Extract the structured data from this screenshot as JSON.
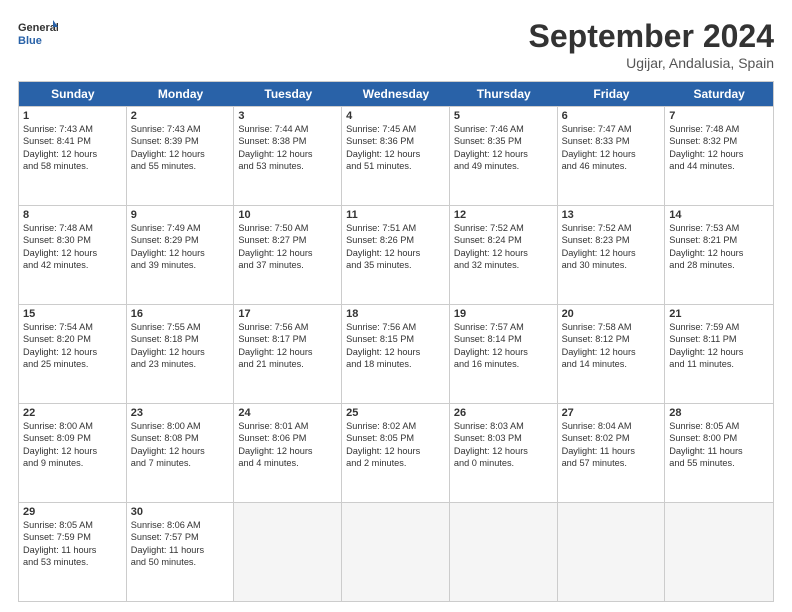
{
  "logo": {
    "text_general": "General",
    "text_blue": "Blue"
  },
  "header": {
    "month": "September 2024",
    "location": "Ugijar, Andalusia, Spain"
  },
  "weekdays": [
    "Sunday",
    "Monday",
    "Tuesday",
    "Wednesday",
    "Thursday",
    "Friday",
    "Saturday"
  ],
  "rows": [
    [
      {
        "day": "",
        "empty": true,
        "lines": []
      },
      {
        "day": "",
        "empty": true,
        "lines": []
      },
      {
        "day": "",
        "empty": true,
        "lines": []
      },
      {
        "day": "",
        "empty": true,
        "lines": []
      },
      {
        "day": "",
        "empty": true,
        "lines": []
      },
      {
        "day": "",
        "empty": true,
        "lines": []
      },
      {
        "day": "",
        "empty": true,
        "lines": []
      }
    ],
    [
      {
        "day": "1",
        "empty": false,
        "lines": [
          "Sunrise: 7:43 AM",
          "Sunset: 8:41 PM",
          "Daylight: 12 hours",
          "and 58 minutes."
        ]
      },
      {
        "day": "2",
        "empty": false,
        "lines": [
          "Sunrise: 7:43 AM",
          "Sunset: 8:39 PM",
          "Daylight: 12 hours",
          "and 55 minutes."
        ]
      },
      {
        "day": "3",
        "empty": false,
        "lines": [
          "Sunrise: 7:44 AM",
          "Sunset: 8:38 PM",
          "Daylight: 12 hours",
          "and 53 minutes."
        ]
      },
      {
        "day": "4",
        "empty": false,
        "lines": [
          "Sunrise: 7:45 AM",
          "Sunset: 8:36 PM",
          "Daylight: 12 hours",
          "and 51 minutes."
        ]
      },
      {
        "day": "5",
        "empty": false,
        "lines": [
          "Sunrise: 7:46 AM",
          "Sunset: 8:35 PM",
          "Daylight: 12 hours",
          "and 49 minutes."
        ]
      },
      {
        "day": "6",
        "empty": false,
        "lines": [
          "Sunrise: 7:47 AM",
          "Sunset: 8:33 PM",
          "Daylight: 12 hours",
          "and 46 minutes."
        ]
      },
      {
        "day": "7",
        "empty": false,
        "lines": [
          "Sunrise: 7:48 AM",
          "Sunset: 8:32 PM",
          "Daylight: 12 hours",
          "and 44 minutes."
        ]
      }
    ],
    [
      {
        "day": "8",
        "empty": false,
        "lines": [
          "Sunrise: 7:48 AM",
          "Sunset: 8:30 PM",
          "Daylight: 12 hours",
          "and 42 minutes."
        ]
      },
      {
        "day": "9",
        "empty": false,
        "lines": [
          "Sunrise: 7:49 AM",
          "Sunset: 8:29 PM",
          "Daylight: 12 hours",
          "and 39 minutes."
        ]
      },
      {
        "day": "10",
        "empty": false,
        "lines": [
          "Sunrise: 7:50 AM",
          "Sunset: 8:27 PM",
          "Daylight: 12 hours",
          "and 37 minutes."
        ]
      },
      {
        "day": "11",
        "empty": false,
        "lines": [
          "Sunrise: 7:51 AM",
          "Sunset: 8:26 PM",
          "Daylight: 12 hours",
          "and 35 minutes."
        ]
      },
      {
        "day": "12",
        "empty": false,
        "lines": [
          "Sunrise: 7:52 AM",
          "Sunset: 8:24 PM",
          "Daylight: 12 hours",
          "and 32 minutes."
        ]
      },
      {
        "day": "13",
        "empty": false,
        "lines": [
          "Sunrise: 7:52 AM",
          "Sunset: 8:23 PM",
          "Daylight: 12 hours",
          "and 30 minutes."
        ]
      },
      {
        "day": "14",
        "empty": false,
        "lines": [
          "Sunrise: 7:53 AM",
          "Sunset: 8:21 PM",
          "Daylight: 12 hours",
          "and 28 minutes."
        ]
      }
    ],
    [
      {
        "day": "15",
        "empty": false,
        "lines": [
          "Sunrise: 7:54 AM",
          "Sunset: 8:20 PM",
          "Daylight: 12 hours",
          "and 25 minutes."
        ]
      },
      {
        "day": "16",
        "empty": false,
        "lines": [
          "Sunrise: 7:55 AM",
          "Sunset: 8:18 PM",
          "Daylight: 12 hours",
          "and 23 minutes."
        ]
      },
      {
        "day": "17",
        "empty": false,
        "lines": [
          "Sunrise: 7:56 AM",
          "Sunset: 8:17 PM",
          "Daylight: 12 hours",
          "and 21 minutes."
        ]
      },
      {
        "day": "18",
        "empty": false,
        "lines": [
          "Sunrise: 7:56 AM",
          "Sunset: 8:15 PM",
          "Daylight: 12 hours",
          "and 18 minutes."
        ]
      },
      {
        "day": "19",
        "empty": false,
        "lines": [
          "Sunrise: 7:57 AM",
          "Sunset: 8:14 PM",
          "Daylight: 12 hours",
          "and 16 minutes."
        ]
      },
      {
        "day": "20",
        "empty": false,
        "lines": [
          "Sunrise: 7:58 AM",
          "Sunset: 8:12 PM",
          "Daylight: 12 hours",
          "and 14 minutes."
        ]
      },
      {
        "day": "21",
        "empty": false,
        "lines": [
          "Sunrise: 7:59 AM",
          "Sunset: 8:11 PM",
          "Daylight: 12 hours",
          "and 11 minutes."
        ]
      }
    ],
    [
      {
        "day": "22",
        "empty": false,
        "lines": [
          "Sunrise: 8:00 AM",
          "Sunset: 8:09 PM",
          "Daylight: 12 hours",
          "and 9 minutes."
        ]
      },
      {
        "day": "23",
        "empty": false,
        "lines": [
          "Sunrise: 8:00 AM",
          "Sunset: 8:08 PM",
          "Daylight: 12 hours",
          "and 7 minutes."
        ]
      },
      {
        "day": "24",
        "empty": false,
        "lines": [
          "Sunrise: 8:01 AM",
          "Sunset: 8:06 PM",
          "Daylight: 12 hours",
          "and 4 minutes."
        ]
      },
      {
        "day": "25",
        "empty": false,
        "lines": [
          "Sunrise: 8:02 AM",
          "Sunset: 8:05 PM",
          "Daylight: 12 hours",
          "and 2 minutes."
        ]
      },
      {
        "day": "26",
        "empty": false,
        "lines": [
          "Sunrise: 8:03 AM",
          "Sunset: 8:03 PM",
          "Daylight: 12 hours",
          "and 0 minutes."
        ]
      },
      {
        "day": "27",
        "empty": false,
        "lines": [
          "Sunrise: 8:04 AM",
          "Sunset: 8:02 PM",
          "Daylight: 11 hours",
          "and 57 minutes."
        ]
      },
      {
        "day": "28",
        "empty": false,
        "lines": [
          "Sunrise: 8:05 AM",
          "Sunset: 8:00 PM",
          "Daylight: 11 hours",
          "and 55 minutes."
        ]
      }
    ],
    [
      {
        "day": "29",
        "empty": false,
        "lines": [
          "Sunrise: 8:05 AM",
          "Sunset: 7:59 PM",
          "Daylight: 11 hours",
          "and 53 minutes."
        ]
      },
      {
        "day": "30",
        "empty": false,
        "lines": [
          "Sunrise: 8:06 AM",
          "Sunset: 7:57 PM",
          "Daylight: 11 hours",
          "and 50 minutes."
        ]
      },
      {
        "day": "",
        "empty": true,
        "lines": []
      },
      {
        "day": "",
        "empty": true,
        "lines": []
      },
      {
        "day": "",
        "empty": true,
        "lines": []
      },
      {
        "day": "",
        "empty": true,
        "lines": []
      },
      {
        "day": "",
        "empty": true,
        "lines": []
      }
    ]
  ]
}
